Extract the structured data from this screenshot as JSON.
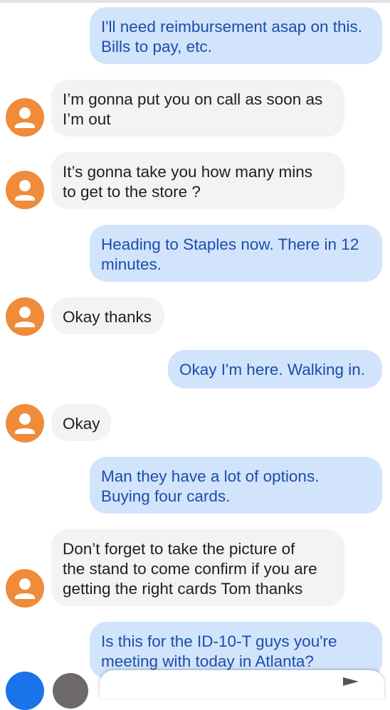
{
  "messages": [
    {
      "direction": "sent",
      "lines": [
        "I'll need reimbursement asap on this.",
        "Bills to pay, etc."
      ]
    },
    {
      "direction": "received",
      "lines": [
        "I’m gonna put you on call as soon as",
        "I’m out"
      ]
    },
    {
      "direction": "received",
      "lines": [
        "It’s gonna take you how many mins",
        "to get to the store ?"
      ]
    },
    {
      "direction": "sent",
      "lines": [
        "Heading to Staples now.  There in 12",
        "minutes."
      ]
    },
    {
      "direction": "received",
      "lines": [
        "Okay thanks"
      ]
    },
    {
      "direction": "sent",
      "lines": [
        "Okay I'm here.  Walking in."
      ]
    },
    {
      "direction": "received",
      "lines": [
        "Okay"
      ]
    },
    {
      "direction": "sent",
      "lines": [
        "Man they have a lot of options.",
        "Buying four cards."
      ]
    },
    {
      "direction": "received",
      "lines": [
        "Don’t forget to take the picture of",
        "the stand to come confirm if you are",
        "getting the right cards Tom thanks"
      ]
    },
    {
      "direction": "sent",
      "lines": [
        "Is this for the ID-10-T guys you're",
        "meeting with today in Atlanta?"
      ]
    }
  ],
  "colors": {
    "sent_bubble": "#d2e3fc",
    "sent_text": "#1a4fa8",
    "received_bubble": "#f1f3f4",
    "received_text": "#1f1f1f",
    "avatar": "#f08b3a"
  },
  "icons": {
    "contact_avatar": "person-icon",
    "send": "send-icon"
  }
}
